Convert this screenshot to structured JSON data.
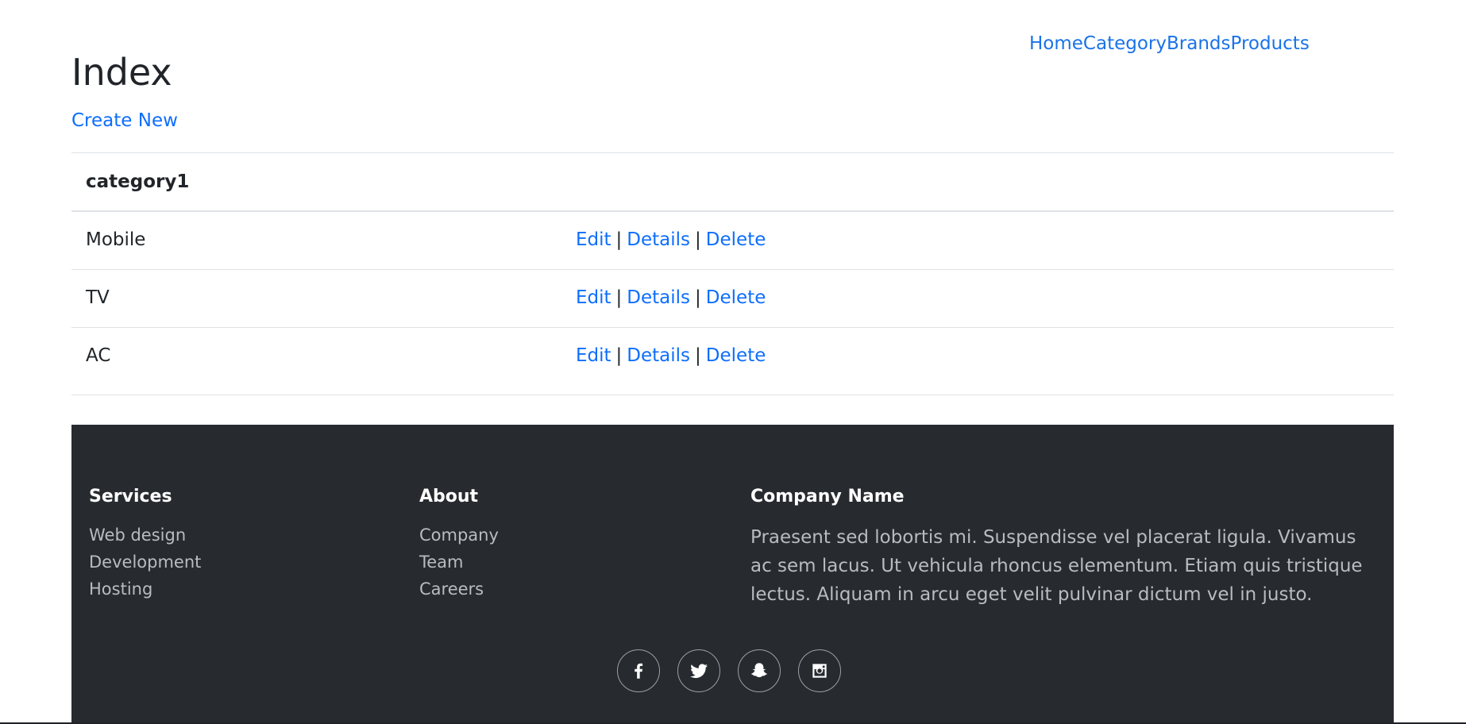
{
  "nav": {
    "items": [
      {
        "label": "Home"
      },
      {
        "label": "Category"
      },
      {
        "label": "Brands"
      },
      {
        "label": "Products"
      }
    ]
  },
  "page": {
    "title": "Index",
    "create_new": "Create New"
  },
  "table": {
    "header": "category1",
    "rows": [
      {
        "name": "Mobile",
        "edit": "Edit",
        "details": "Details",
        "delete": "Delete"
      },
      {
        "name": "TV",
        "edit": "Edit",
        "details": "Details",
        "delete": "Delete"
      },
      {
        "name": "AC",
        "edit": "Edit",
        "details": "Details",
        "delete": "Delete"
      }
    ],
    "separator": "|"
  },
  "footer": {
    "services": {
      "heading": "Services",
      "links": [
        "Web design",
        "Development",
        "Hosting"
      ]
    },
    "about": {
      "heading": "About",
      "links": [
        "Company",
        "Team",
        "Careers"
      ]
    },
    "company": {
      "heading": "Company Name",
      "text": "Praesent sed lobortis mi. Suspendisse vel placerat ligula. Vivamus ac sem lacus. Ut vehicula rhoncus elementum. Etiam quis tristique lectus. Aliquam in arcu eget velit pulvinar dictum vel in justo."
    },
    "social": [
      "facebook-icon",
      "twitter-icon",
      "snapchat-icon",
      "instagram-icon"
    ]
  },
  "colors": {
    "link": "#0d6efd",
    "footer_bg": "#272b30",
    "footer_text": "#b8bcc1"
  }
}
